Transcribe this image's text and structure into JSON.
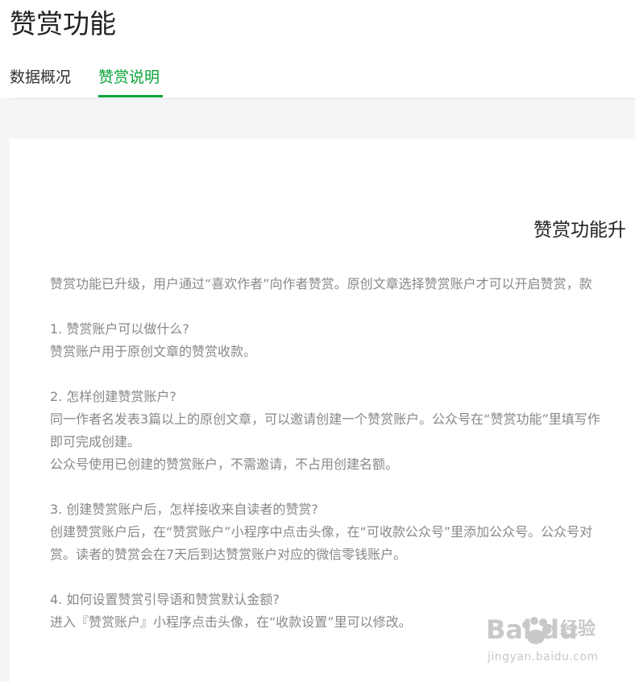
{
  "page": {
    "title": "赞赏功能"
  },
  "tabs": [
    {
      "label": "数据概况",
      "active": false
    },
    {
      "label": "赞赏说明",
      "active": true
    }
  ],
  "article": {
    "title": "赞赏功能升",
    "intro": "赞赏功能已升级，用户通过“喜欢作者”向作者赞赏。原创文章选择赞赏账户才可以开启赞赏，款",
    "q1": {
      "question": "1. 赞赏账户可以做什么?",
      "answer": "赞赏账户用于原创文章的赞赏收款。"
    },
    "q2": {
      "question": "2. 怎样创建赞赏账户?",
      "answer_1": "同一作者名发表3篇以上的原创文章，可以邀请创建一个赞赏账户。公众号在“赞赏功能”里填写作",
      "answer_2": "即可完成创建。",
      "answer_3": "公众号使用已创建的赞赏账户，不需邀请，不占用创建名额。"
    },
    "q3": {
      "question": "3. 创建赞赏账户后，怎样接收来自读者的赞赏?",
      "answer_1": "创建赞赏账户后，在“赞赏账户”小程序中点击头像，在“可收款公众号”里添加公众号。公众号对",
      "answer_2": "赏。读者的赞赏会在7天后到达赞赏账户对应的微信零钱账户。"
    },
    "q4": {
      "question": "4. 如何设置赞赏引导语和赞赏默认金额?",
      "answer": "进入『赞赏账户』小程序点击头像，在“收款设置”里可以修改。"
    }
  },
  "watermark": {
    "logo": "Bai du",
    "jingyan": "经验",
    "url": "jingyan.baidu.com"
  }
}
